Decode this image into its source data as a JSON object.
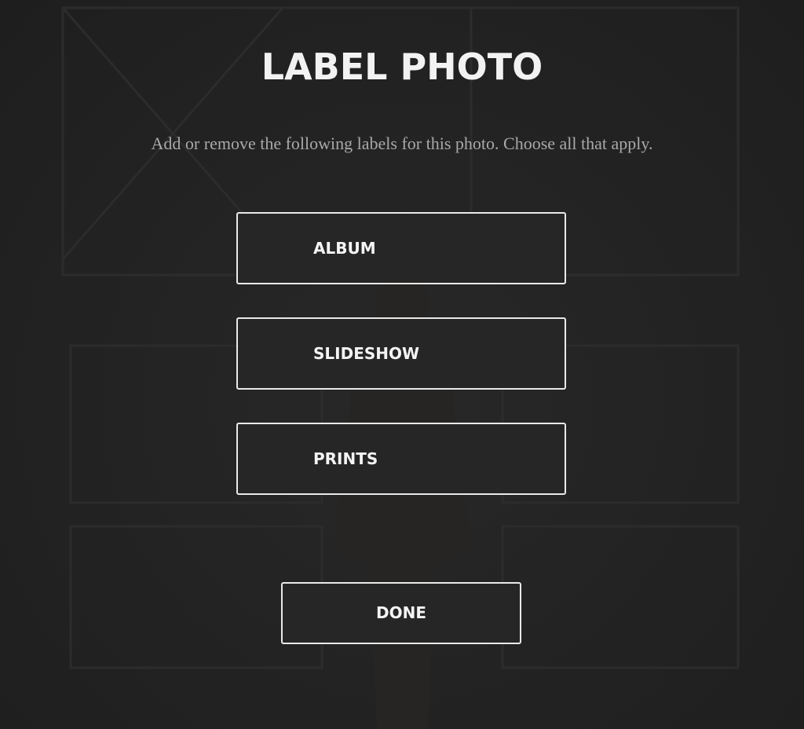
{
  "dialog": {
    "title": "LABEL PHOTO",
    "subtitle": "Add or remove the following labels for this photo. Choose all that apply.",
    "options": [
      {
        "label": "ALBUM"
      },
      {
        "label": "SLIDESHOW"
      },
      {
        "label": "PRINTS"
      }
    ],
    "done_label": "DONE"
  },
  "colors": {
    "overlay": "#232323",
    "text": "#f2f2f2",
    "subtitle": "#a9a9a9",
    "button_border": "#e9e9e9"
  }
}
